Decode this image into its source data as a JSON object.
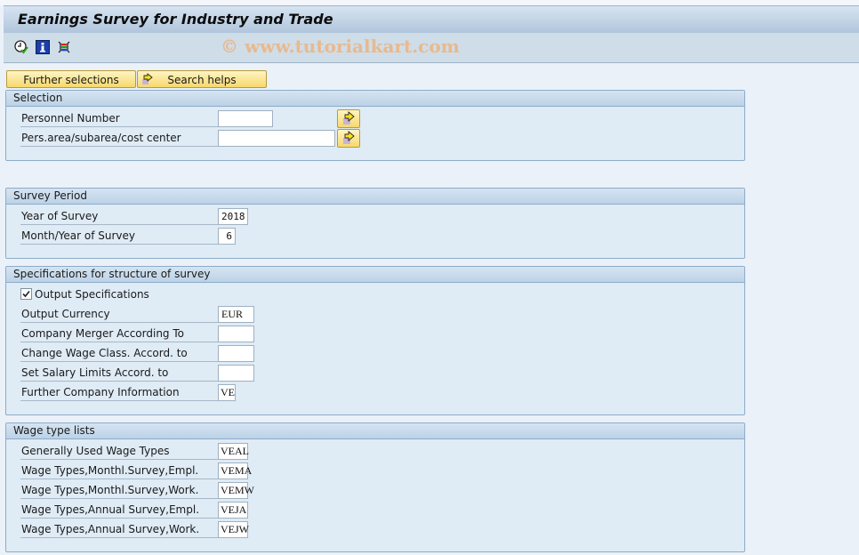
{
  "window": {
    "title": "Earnings Survey for Industry and Trade",
    "watermark": "© www.tutorialkart.com"
  },
  "toolbar": {
    "icons": [
      "execute-clock-icon",
      "info-icon",
      "variant-list-icon"
    ]
  },
  "buttons": {
    "further_selections": "Further selections",
    "search_helps": "Search helps"
  },
  "selection": {
    "title": "Selection",
    "personnel_number": {
      "label": "Personnel Number",
      "value": ""
    },
    "pers_area": {
      "label": "Pers.area/subarea/cost center",
      "value": ""
    }
  },
  "survey_period": {
    "title": "Survey Period",
    "year": {
      "label": "Year of Survey",
      "value": "2018"
    },
    "month": {
      "label": "Month/Year of Survey",
      "value": "6"
    }
  },
  "specifications": {
    "title": "Specifications for structure of survey",
    "output_specifications": {
      "label": "Output Specifications",
      "checked": true
    },
    "output_currency": {
      "label": "Output Currency",
      "value": "EUR"
    },
    "company_merger": {
      "label": "Company Merger According To",
      "value": ""
    },
    "change_wage_class": {
      "label": "Change Wage Class. Accord. to",
      "value": ""
    },
    "salary_limits": {
      "label": "Set Salary Limits Accord. to",
      "value": ""
    },
    "further_company_info": {
      "label": "Further Company Information",
      "value": "VE"
    }
  },
  "wage_types": {
    "title": "Wage type lists",
    "items": [
      {
        "label": "Generally Used Wage Types",
        "value": "VEAL"
      },
      {
        "label": "Wage Types,Monthl.Survey,Empl.",
        "value": "VEMA"
      },
      {
        "label": "Wage Types,Monthl.Survey,Work.",
        "value": "VEMW"
      },
      {
        "label": "Wage Types,Annual Survey,Empl.",
        "value": "VEJA"
      },
      {
        "label": "Wage Types,Annual Survey,Work.",
        "value": "VEJW"
      }
    ]
  }
}
